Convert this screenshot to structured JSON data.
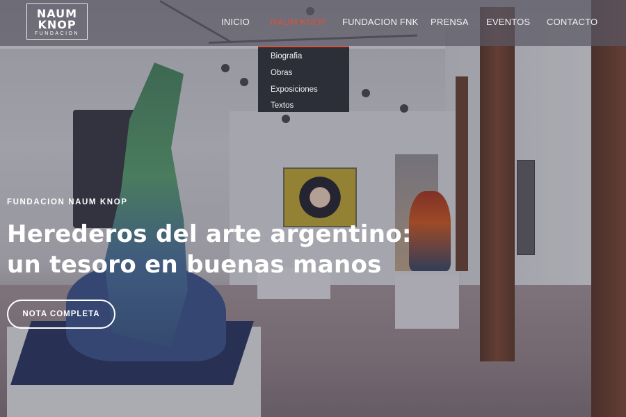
{
  "logo": {
    "line1": "NAUM",
    "line2": "KNOP",
    "line3": "FUNDACION"
  },
  "nav": {
    "items": [
      {
        "label": "INICIO",
        "active": false
      },
      {
        "label": "NAUM KNOP",
        "active": true
      },
      {
        "label": "FUNDACION FNK",
        "active": false
      },
      {
        "label": "PRENSA",
        "active": false
      },
      {
        "label": "EVENTOS",
        "active": false
      },
      {
        "label": "CONTACTO",
        "active": false
      }
    ],
    "active_color": "#d9523a"
  },
  "dropdown": {
    "items": [
      "Biografia",
      "Obras",
      "Exposiciones",
      "Textos"
    ]
  },
  "hero": {
    "eyebrow": "FUNDACION NAUM KNOP",
    "headline_line1": "Herederos del arte argentino:",
    "headline_line2": "un tesoro en buenas manos",
    "cta_label": "NOTA COMPLETA"
  }
}
